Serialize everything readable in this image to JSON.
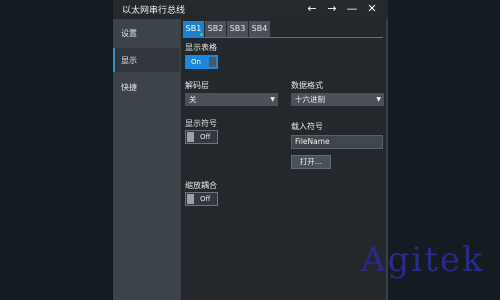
{
  "window": {
    "title": "以太网串行总线",
    "controls": {
      "back": "←",
      "forward": "→",
      "minimize": "—",
      "close": "✕"
    }
  },
  "sidebar": {
    "items": [
      {
        "label": "设置"
      },
      {
        "label": "显示",
        "active": true
      },
      {
        "label": "快捷"
      }
    ],
    "accent_color": "#2f8fd6"
  },
  "tabs": [
    {
      "label": "SB1",
      "active": true
    },
    {
      "label": "SB2"
    },
    {
      "label": "SB3"
    },
    {
      "label": "SB4"
    }
  ],
  "display": {
    "show_table": {
      "label": "显示表格",
      "state": "On"
    },
    "decode_layer": {
      "label": "解码层",
      "value": "关"
    },
    "data_format": {
      "label": "数据格式",
      "value": "十六进制"
    },
    "show_symbols": {
      "label": "显示符号",
      "state": "Off"
    },
    "load_symbols": {
      "label": "载入符号",
      "file_value": "FileName",
      "open_button": "打开..."
    },
    "zoom_coupling": {
      "label": "缩放耦合",
      "state": "Off"
    }
  },
  "watermark": {
    "text": "Agitek",
    "color": "#2a2a8c"
  }
}
